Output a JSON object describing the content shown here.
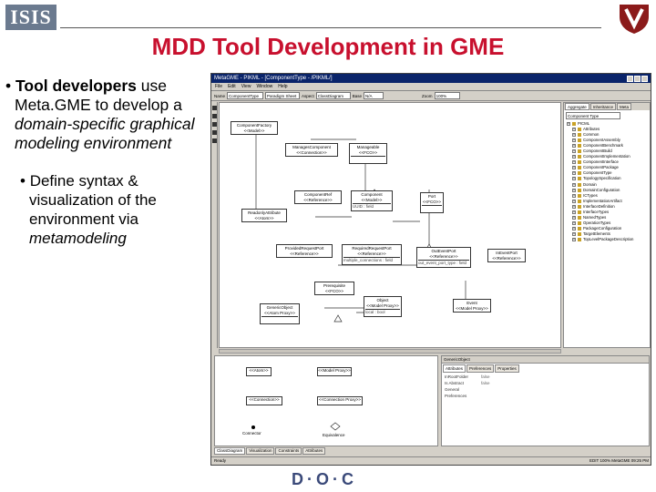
{
  "slide": {
    "title": "MDD Tool Development in GME",
    "logo_left": "ISIS",
    "bullet1": {
      "bold": "Tool developers",
      "rest1": " use Meta.GME to develop a ",
      "italic": "domain-specific graphical modeling environment"
    },
    "bullet2": {
      "text": "Define syntax & visualization of the environment via ",
      "italic": "metamodeling"
    },
    "footer_logo": "D·O·C"
  },
  "app": {
    "title": "MetaGME - PIKML - [ComponentType - /PIKML/]",
    "menu": [
      "File",
      "Edit",
      "View",
      "Window",
      "Help"
    ],
    "toolbar": {
      "name_label": "Name",
      "name_value": "ComponentType",
      "kind_value": "Paradigm Sheet",
      "aspect_label": "Aspect",
      "aspect_value": "ClassDiagram",
      "base_label": "Base",
      "base_value": "N/A",
      "zoom_label": "Zoom",
      "zoom_value": "100%"
    },
    "classes": [
      {
        "name": "ComponentFactory",
        "stereo": "<<Model>>"
      },
      {
        "name": "ManagesComponent",
        "stereo": "<<Connection>>"
      },
      {
        "name": "Manageable",
        "stereo": "<<FCO>>"
      },
      {
        "name": "ComponentRef",
        "stereo": "<<Reference>>"
      },
      {
        "name": "Component",
        "stereo": "<<Model>>",
        "attr": "UUID : field"
      },
      {
        "name": "Port",
        "stereo": "<<FCO>>"
      },
      {
        "name": "ReadonlyAttribute",
        "stereo": "<<Atom>>"
      },
      {
        "name": "ProvidedRequestPort",
        "stereo": "<<Reference>>"
      },
      {
        "name": "RequiredRequestPort",
        "stereo": "<<Reference>>",
        "attr": "multiple_connections : field"
      },
      {
        "name": "OutEventPort",
        "stereo": "<<Reference>>",
        "attr": "out_event_port_type : field"
      },
      {
        "name": "InEventPort",
        "stereo": "<<Reference>>"
      },
      {
        "name": "Prerequisite",
        "stereo": "<<FCO>>"
      },
      {
        "name": "Object",
        "stereo": "<<Model Proxy>>",
        "attr": "local : bool"
      },
      {
        "name": "Event",
        "stereo": "<<Model Proxy>>"
      },
      {
        "name": "GenericObject",
        "stereo": "<<Atom Proxy>>"
      }
    ],
    "browser": {
      "tabs": [
        "Aggregate",
        "Inheritance",
        "Meta"
      ],
      "select": "Component Type",
      "items": [
        "PICML",
        "Attributes",
        "Common",
        "ComponentAssembly",
        "ComponentBenchmark",
        "ComponentBuild",
        "ComponentImplementation",
        "ComponentInterface",
        "ComponentPackage",
        "ComponentType",
        "TopologySpecification",
        "Domain",
        "DomainConfiguration",
        "ICTypes",
        "ImplementationArtifact",
        "InterfaceDefinition",
        "InterfaceTypes",
        "NamedTypes",
        "OperationTypes",
        "PackageConfiguration",
        "TargetElements",
        "TopLevelPackageDescription"
      ]
    },
    "panel": {
      "boxes": [
        "<<Atom>>",
        "<<Model Proxy>>",
        "<<Connection>>",
        "<<Connection Proxy>>",
        "Connector",
        "Equivalence"
      ],
      "tabs": [
        "ClassDiagram",
        "Visualization",
        "Constraints",
        "Attributes"
      ]
    },
    "attributes": {
      "title": "GenericObject",
      "tabs": [
        "Attributes",
        "Preferences",
        "Properties"
      ],
      "rows": [
        {
          "k": "InRootFolder",
          "v": "false"
        },
        {
          "k": "Is Abstract",
          "v": "false"
        },
        {
          "k": "General Preferences",
          "v": ""
        }
      ]
    },
    "status": {
      "left": "Ready",
      "right": "EDIT  100%  MetaGME  09:25 PM"
    }
  }
}
